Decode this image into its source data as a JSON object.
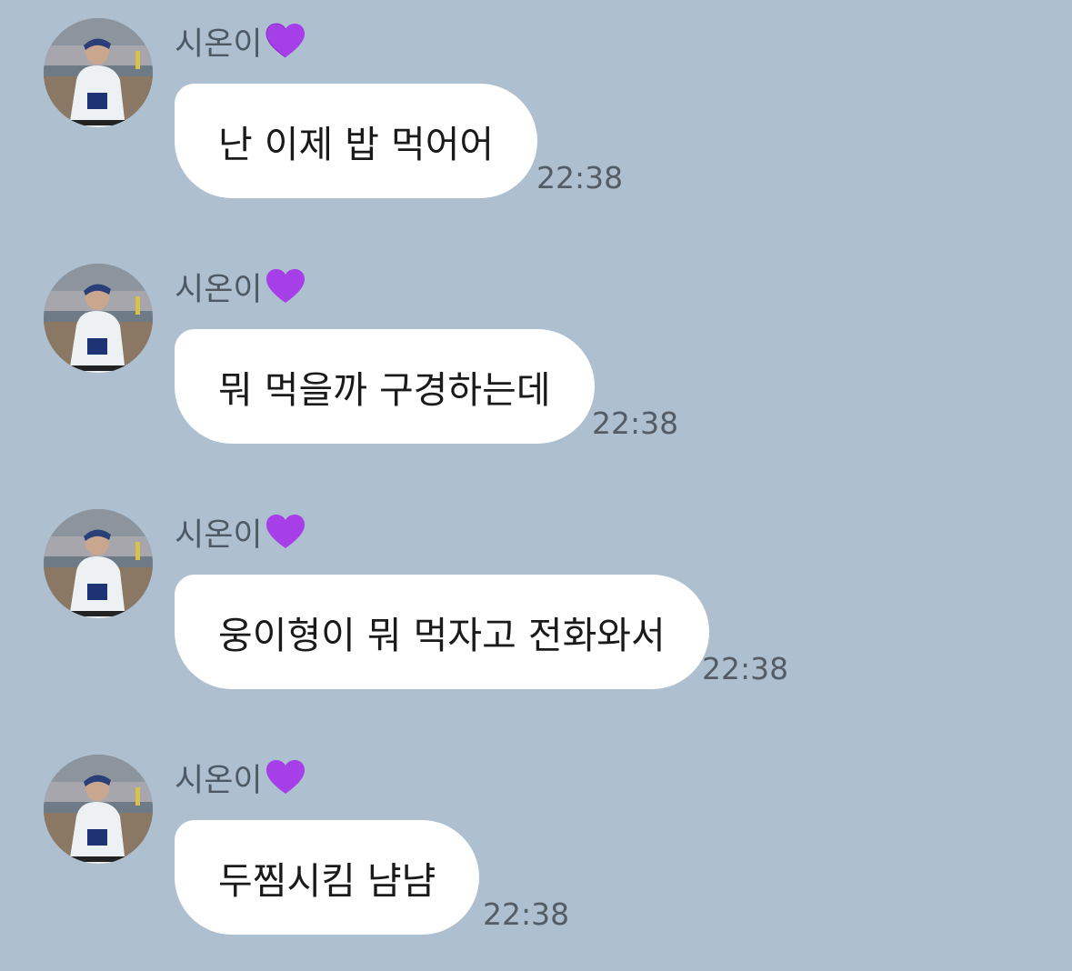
{
  "messages": [
    {
      "sender": "시온이",
      "sender_emoji": "purple-heart",
      "text": "난 이제 밥 먹어어",
      "time": "22:38"
    },
    {
      "sender": "시온이",
      "sender_emoji": "purple-heart",
      "text": "뭐 먹을까 구경하는데",
      "time": "22:38"
    },
    {
      "sender": "시온이",
      "sender_emoji": "purple-heart",
      "text": "웅이형이 뭐 먹자고 전화와서",
      "time": "22:38"
    },
    {
      "sender": "시온이",
      "sender_emoji": "purple-heart",
      "text": "두찜시킴 냠냠",
      "time": "22:38"
    }
  ],
  "colors": {
    "background": "#aec0cf",
    "bubble": "#ffffff",
    "message_text": "#1a1a1a",
    "sender_text": "#4e5963",
    "timestamp_text": "#545d66",
    "heart": "#a63fe8"
  }
}
